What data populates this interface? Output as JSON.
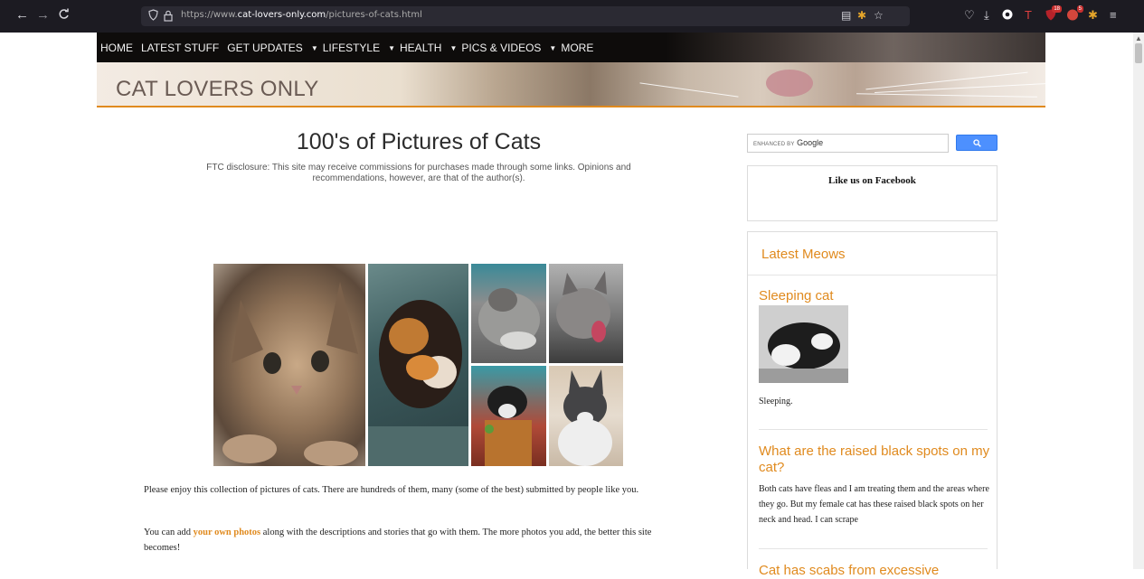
{
  "browser": {
    "back_label": "←",
    "forward_label": "→",
    "reload_label": "C",
    "url_prefix": "https://www.",
    "url_domain": "cat-lovers-only.com",
    "url_path": "/pictures-of-cats.html",
    "badges": {
      "ext1": "18",
      "ext2": "5"
    }
  },
  "site": {
    "nav": {
      "home": "HOME",
      "latest": "LATEST STUFF",
      "updates": "GET UPDATES",
      "lifestyle": "LIFESTYLE",
      "health": "HEALTH",
      "pics": "PICS & VIDEOS",
      "more": "MORE"
    },
    "brand": "CAT LOVERS ONLY"
  },
  "main": {
    "title": "100's of Pictures of Cats",
    "ftc": "FTC disclosure: This site may receive commissions for purchases made through some links. Opinions and recommendations, however, are that of the author(s).",
    "para1": "Please enjoy this collection of pictures of cats. There are hundreds of them, many (some of the best) submitted by people like you.",
    "para2_before": "You can add ",
    "para2_link": "your own photos",
    "para2_after": " along with the descriptions and stories that go with them. The more photos you add, the better this site becomes!"
  },
  "sidebar": {
    "search_prefix": "ENHANCED BY",
    "search_brand": "Google",
    "search_button_icon": "search-icon",
    "facebook": "Like us on Facebook",
    "latest_heading": "Latest Meows",
    "posts": [
      {
        "title": "Sleeping cat",
        "text": "Sleeping."
      },
      {
        "title": "What are the raised black spots on my cat?",
        "text": "Both cats have fleas and I am treating them and the areas where they go. But my female cat has these raised black spots on her neck and head. I can scrape"
      },
      {
        "title": "Cat has scabs from excessive",
        "text": ""
      }
    ]
  },
  "colors": {
    "accent": "#e08a1e",
    "nav_bg": "#0e0c0b",
    "chrome_bg": "#1c1b22",
    "search_button": "#4d90fe"
  }
}
